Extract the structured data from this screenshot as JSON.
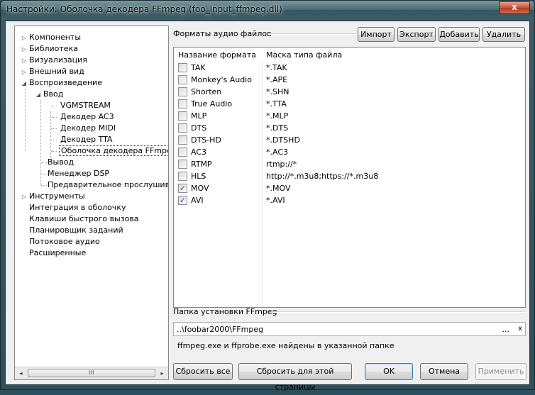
{
  "window": {
    "title": "Настройки: Оболочка декодера FFmpeg (foo_input_ffmpeg.dll)",
    "close_label": "x"
  },
  "tree": {
    "items": [
      {
        "label": "Компоненты",
        "expander": "▷"
      },
      {
        "label": "Библиотека",
        "expander": "▷"
      },
      {
        "label": "Визуализация",
        "expander": "▷"
      },
      {
        "label": "Внешний вид",
        "expander": "▷"
      },
      {
        "label": "Воспроизведение",
        "expander": "◢"
      },
      {
        "label": "Ввод",
        "expander": "◢"
      },
      {
        "label": "VGMSTREAM",
        "expander": ""
      },
      {
        "label": "Декодер AC3",
        "expander": ""
      },
      {
        "label": "Декодер MIDI",
        "expander": ""
      },
      {
        "label": "Декодер TTA",
        "expander": ""
      },
      {
        "label": "Оболочка декодера FFmpeg",
        "expander": ""
      },
      {
        "label": "Вывод",
        "expander": ""
      },
      {
        "label": "Менеджер DSP",
        "expander": ""
      },
      {
        "label": "Предварительное прослушивание",
        "expander": ""
      },
      {
        "label": "Инструменты",
        "expander": "▷"
      },
      {
        "label": "Интеграция в оболочку",
        "expander": ""
      },
      {
        "label": "Клавиши быстрого вызова",
        "expander": ""
      },
      {
        "label": "Планировщик заданий",
        "expander": ""
      },
      {
        "label": "Потоковое аудио",
        "expander": ""
      },
      {
        "label": "Расширенные",
        "expander": ""
      }
    ],
    "scroll_left": "◂",
    "scroll_right": "▸",
    "scroll_grip": "III"
  },
  "formats": {
    "section_label": "Форматы аудио файлов",
    "buttons": {
      "import": "Импорт",
      "export": "Экспорт",
      "add": "Добавить",
      "remove": "Удалить"
    },
    "columns": [
      "Название формата",
      "Маска типа файла"
    ],
    "rows": [
      {
        "name": "TAK",
        "mask": "*.TAK",
        "checked": false
      },
      {
        "name": "Monkey's Audio",
        "mask": "*.APE",
        "checked": false
      },
      {
        "name": "Shorten",
        "mask": "*.SHN",
        "checked": false
      },
      {
        "name": "True Audio",
        "mask": "*.TTA",
        "checked": false
      },
      {
        "name": "MLP",
        "mask": "*.MLP",
        "checked": false
      },
      {
        "name": "DTS",
        "mask": "*.DTS",
        "checked": false
      },
      {
        "name": "DTS-HD",
        "mask": "*.DTSHD",
        "checked": false
      },
      {
        "name": "AC3",
        "mask": "*.AC3",
        "checked": false
      },
      {
        "name": "RTMP",
        "mask": "rtmp://*",
        "checked": false
      },
      {
        "name": "HLS",
        "mask": "http://*.m3u8;https://*.m3u8",
        "checked": false
      },
      {
        "name": "MOV",
        "mask": "*.MOV",
        "checked": true
      },
      {
        "name": "AVI",
        "mask": "*.AVI",
        "checked": true
      }
    ],
    "check_mark": "✓"
  },
  "ffmpeg": {
    "section_label": "Папка установки FFmpeg",
    "path_value": "..\\foobar2000\\FFmpeg",
    "browse_label": "...",
    "clear_label": "x",
    "status_text": "ffmpeg.exe и ffprobe.exe найдены в указанной папке"
  },
  "footer": {
    "reset_all": "Сбросить все",
    "reset_page": "Сбросить для этой страницы",
    "ok": "OK",
    "cancel": "Отмена",
    "apply": "Применить"
  }
}
